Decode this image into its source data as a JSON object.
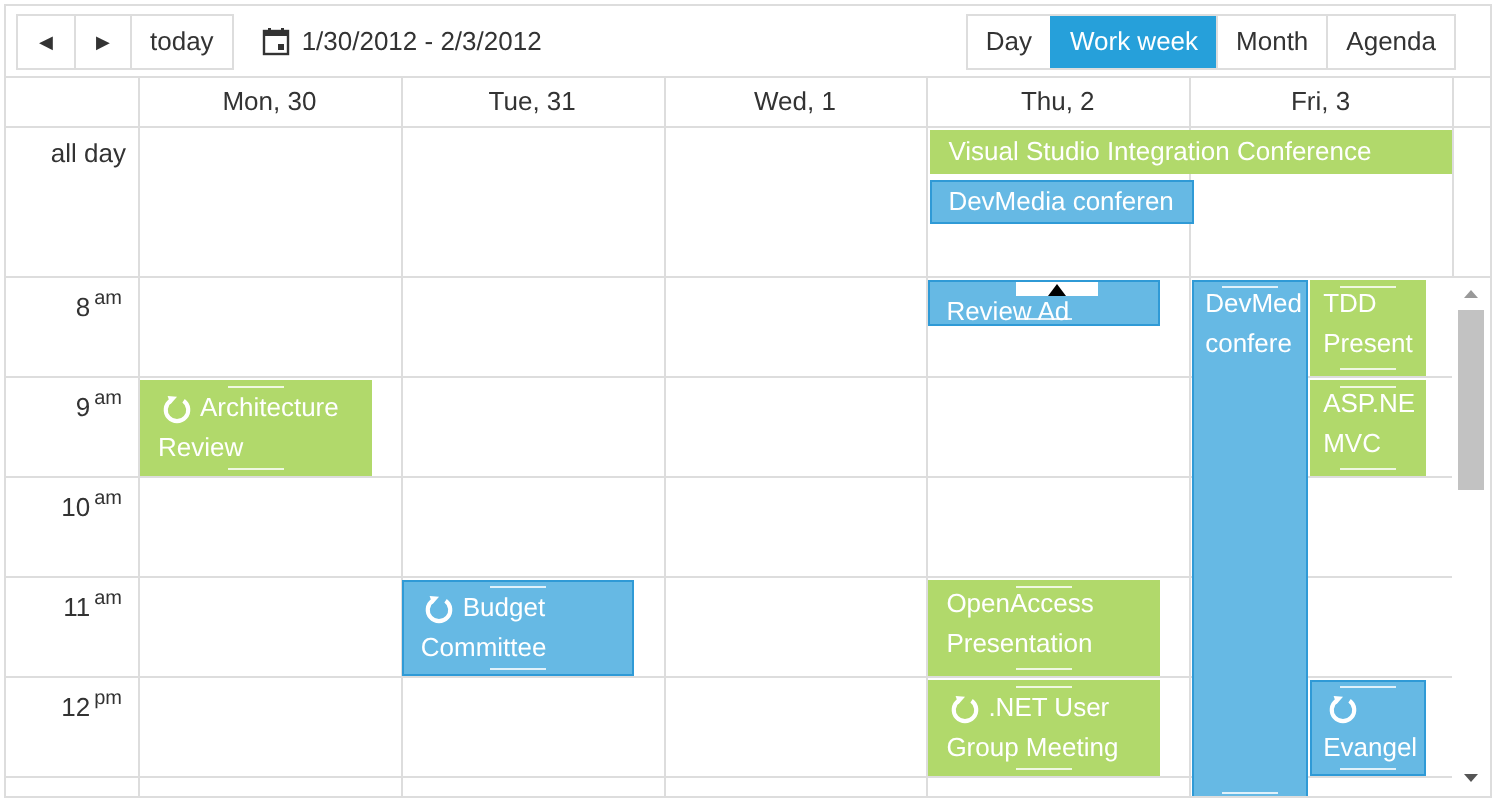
{
  "toolbar": {
    "prev": "◀",
    "next": "▶",
    "today": "today",
    "date_range": "1/30/2012 - 2/3/2012",
    "views": [
      {
        "label": "Day",
        "selected": false
      },
      {
        "label": "Work week",
        "selected": true
      },
      {
        "label": "Month",
        "selected": false
      },
      {
        "label": "Agenda",
        "selected": false
      }
    ]
  },
  "days": [
    "Mon, 30",
    "Tue, 31",
    "Wed, 1",
    "Thu, 2",
    "Fri, 3"
  ],
  "all_day_label": "all day",
  "all_day_events": [
    {
      "title": "Visual Studio Integration Conference",
      "color": "#b1d96b"
    },
    {
      "title": "DevMedia conferen",
      "color": "#66b9e4"
    }
  ],
  "times": [
    "8$^{am}$",
    "9$^{am}$",
    "10$^{am}$",
    "11$^{am}$",
    "12$^{pm}$"
  ],
  "events": [
    {
      "title": "Review Ad",
      "color": "#66b9e4",
      "recurring": false
    },
    {
      "title": "DevMed confere",
      "color": "#66b9e4",
      "recurring": false
    },
    {
      "title": "TDD Present",
      "color": "#b1d96b",
      "recurring": false
    },
    {
      "title": "Architecture Review",
      "color": "#b1d96b",
      "recurring": true
    },
    {
      "title": "ASP.NE MVC",
      "color": "#b1d96b",
      "recurring": false
    },
    {
      "title": "Budget Committee",
      "color": "#66b9e4",
      "recurring": true
    },
    {
      "title": "OpenAccess Presentation",
      "color": "#b1d96b",
      "recurring": false
    },
    {
      "title": ".NET User Group Meeting",
      "color": "#b1d96b",
      "recurring": true
    },
    {
      "title": "Evangel",
      "color": "#66b9e4",
      "recurring": true
    }
  ]
}
